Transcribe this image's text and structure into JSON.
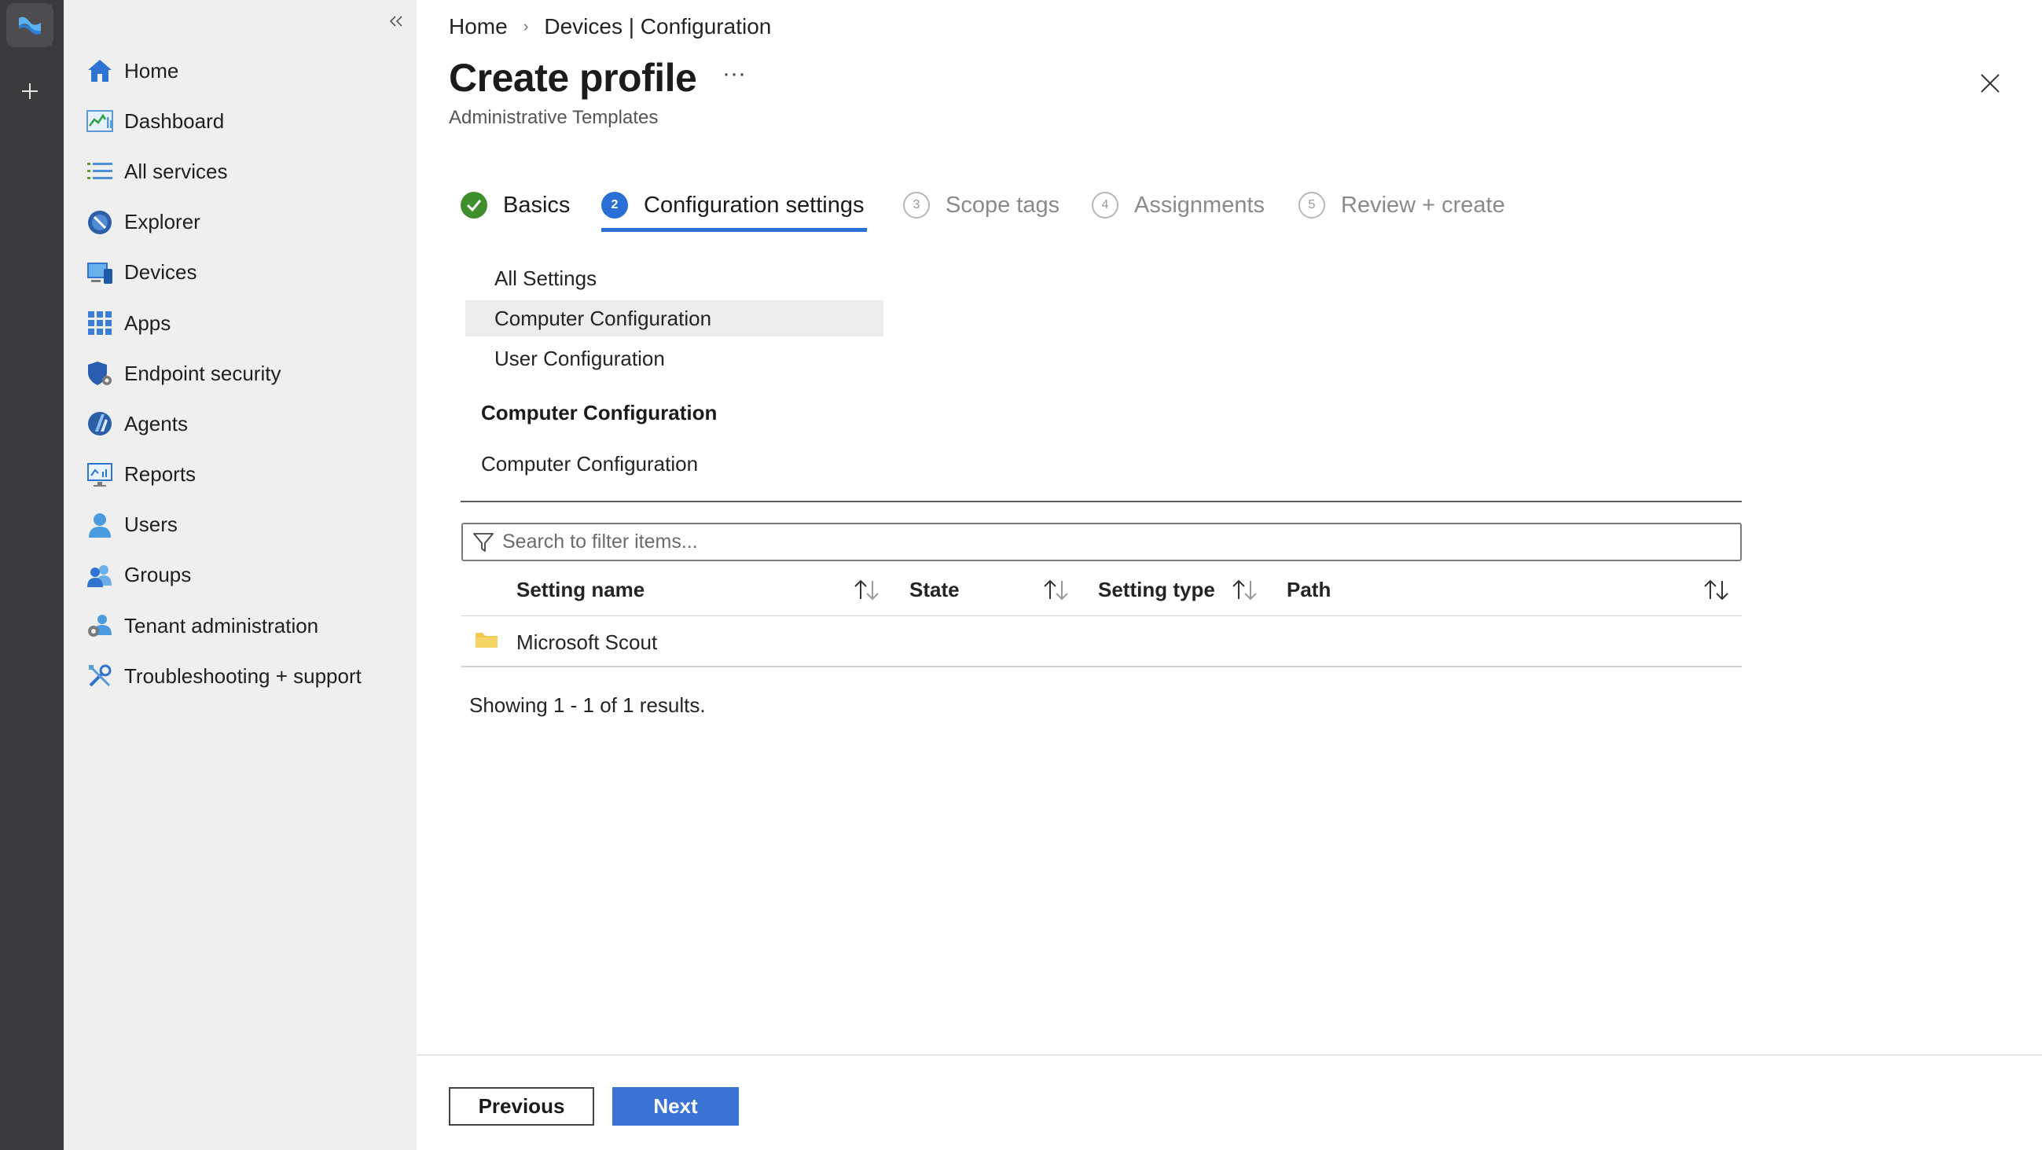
{
  "colors": {
    "rail_bg": "#3b3b3d",
    "sidebar_bg": "#efefef",
    "accent": "#2a6fd6",
    "success": "#3f8f2c",
    "primary_button": "#3a73d3"
  },
  "rail": {
    "app_icon": "intune-logo-icon",
    "add_icon": "plus-icon"
  },
  "sidebar": {
    "collapse_icon": "double-chevron-left-icon",
    "items": [
      {
        "label": "Home",
        "icon": "home-icon"
      },
      {
        "label": "Dashboard",
        "icon": "dashboard-icon"
      },
      {
        "label": "All services",
        "icon": "list-icon"
      },
      {
        "label": "Explorer",
        "icon": "explorer-icon"
      },
      {
        "label": "Devices",
        "icon": "devices-icon"
      },
      {
        "label": "Apps",
        "icon": "apps-grid-icon"
      },
      {
        "label": "Endpoint security",
        "icon": "shield-gear-icon"
      },
      {
        "label": "Agents",
        "icon": "agents-icon"
      },
      {
        "label": "Reports",
        "icon": "reports-icon"
      },
      {
        "label": "Users",
        "icon": "user-icon"
      },
      {
        "label": "Groups",
        "icon": "groups-icon"
      },
      {
        "label": "Tenant administration",
        "icon": "tenant-admin-icon"
      },
      {
        "label": "Troubleshooting + support",
        "icon": "wrench-icon"
      }
    ]
  },
  "breadcrumb": [
    "Home",
    "Devices | Configuration"
  ],
  "header": {
    "title": "Create profile",
    "more": "···",
    "subtitle": "Administrative Templates",
    "close_icon": "close-icon"
  },
  "wizard": {
    "steps": [
      {
        "number": "1",
        "label": "Basics",
        "status": "complete"
      },
      {
        "number": "2",
        "label": "Configuration settings",
        "status": "current"
      },
      {
        "number": "3",
        "label": "Scope tags",
        "status": "pending"
      },
      {
        "number": "4",
        "label": "Assignments",
        "status": "pending"
      },
      {
        "number": "5",
        "label": "Review + create",
        "status": "pending"
      }
    ]
  },
  "tree": {
    "items": [
      "All Settings",
      "Computer Configuration",
      "User Configuration"
    ],
    "selected": "Computer Configuration"
  },
  "section": {
    "heading": "Computer Configuration",
    "breadcrumb": "Computer Configuration"
  },
  "search": {
    "placeholder": "Search to filter items...",
    "value": ""
  },
  "table": {
    "columns": [
      "Setting name",
      "State",
      "Setting type",
      "Path"
    ],
    "rows": [
      {
        "name": "Microsoft Scout",
        "icon": "folder-icon",
        "state": "",
        "setting_type": "",
        "path": ""
      }
    ],
    "summary": "Showing 1 - 1 of 1 results."
  },
  "footer": {
    "previous_label": "Previous",
    "next_label": "Next"
  }
}
